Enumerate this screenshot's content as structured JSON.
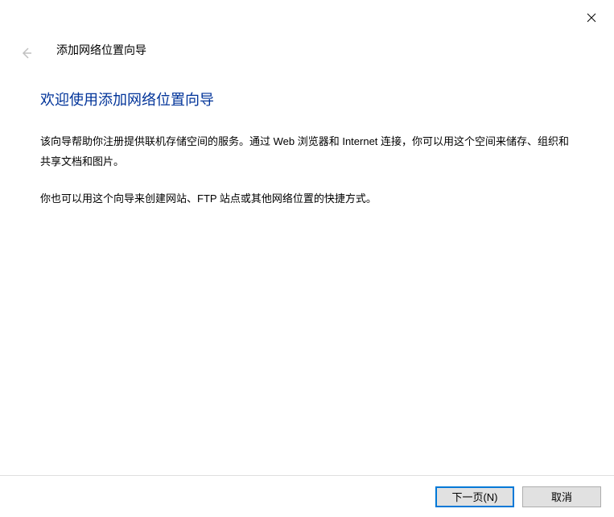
{
  "header": {
    "title": "添加网络位置向导"
  },
  "content": {
    "heading": "欢迎使用添加网络位置向导",
    "paragraph1": "该向导帮助你注册提供联机存储空间的服务。通过 Web 浏览器和 Internet 连接，你可以用这个空间来储存、组织和共享文档和图片。",
    "paragraph2": "你也可以用这个向导来创建网站、FTP 站点或其他网络位置的快捷方式。"
  },
  "footer": {
    "next_label": "下一页(N)",
    "cancel_label": "取消"
  }
}
